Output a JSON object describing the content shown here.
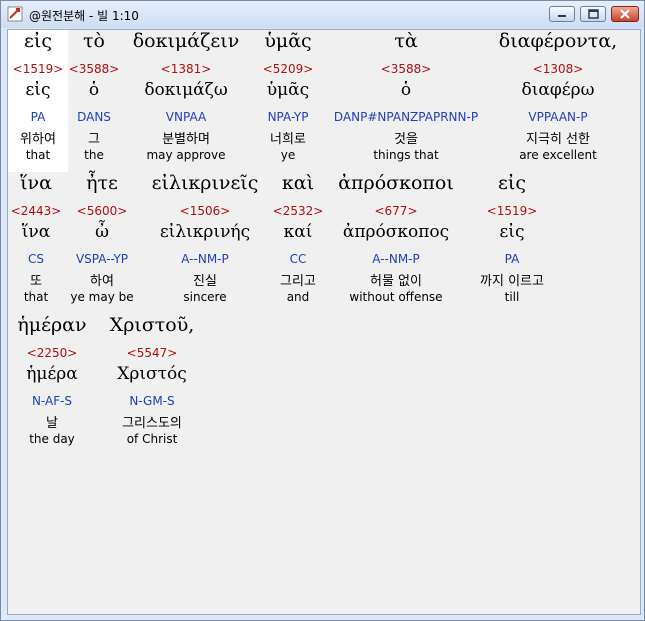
{
  "window": {
    "title": "@원전분해 - 빌 1:10",
    "controls": {
      "minimize": "minimize",
      "maximize": "maximize",
      "close": "close"
    }
  },
  "words": [
    {
      "greek": "εἰς",
      "strong": "<1519>",
      "lemma": "εἰς",
      "morph": "PA",
      "korean": "위하여",
      "english": "that"
    },
    {
      "greek": "τὸ",
      "strong": "<3588>",
      "lemma": "ὁ",
      "morph": "DANS",
      "korean": "그",
      "english": "the"
    },
    {
      "greek": "δοκιμάζειν",
      "strong": "<1381>",
      "lemma": "δοκιμάζω",
      "morph": "VNPAA",
      "korean": "분별하며",
      "english": "may approve"
    },
    {
      "greek": "ὑμᾶς",
      "strong": "<5209>",
      "lemma": "ὑμᾶς",
      "morph": "NPA-YP",
      "korean": "너희로",
      "english": "ye"
    },
    {
      "greek": "τὰ",
      "strong": "<3588>",
      "lemma": "ὁ",
      "morph": "DANP#NPANZPAPRNN-P",
      "korean": "것을",
      "english": "things that"
    },
    {
      "greek": "διαφέροντα,",
      "strong": "<1308>",
      "lemma": "διαφέρω",
      "morph": "VPPAAN-P",
      "korean": "지극히 선한",
      "english": "are excellent"
    },
    {
      "greek": "ἵνα",
      "strong": "<2443>",
      "lemma": "ἵνα",
      "morph": "CS",
      "korean": "또",
      "english": "that"
    },
    {
      "greek": "ἦτε",
      "strong": "<5600>",
      "lemma": "ὦ",
      "morph": "VSPA--YP",
      "korean": "하여",
      "english": "ye may be"
    },
    {
      "greek": "εἰλικρινεῖς",
      "strong": "<1506>",
      "lemma": "εἰλικρινής",
      "morph": "A--NM-P",
      "korean": "진실",
      "english": "sincere"
    },
    {
      "greek": "καὶ",
      "strong": "<2532>",
      "lemma": "καί",
      "morph": "CC",
      "korean": "그리고",
      "english": "and"
    },
    {
      "greek": "ἀπρόσκοποι",
      "strong": "<677>",
      "lemma": "ἀπρόσκοπος",
      "morph": "A--NM-P",
      "korean": "허물 없이",
      "english": "without offense"
    },
    {
      "greek": "εἰς",
      "strong": "<1519>",
      "lemma": "εἰς",
      "morph": "PA",
      "korean": "까지 이르고",
      "english": "till"
    },
    {
      "greek": "ἡμέραν",
      "strong": "<2250>",
      "lemma": "ἡμέρα",
      "morph": "N-AF-S",
      "korean": "날",
      "english": "the day"
    },
    {
      "greek": "Χριστοῦ,",
      "strong": "<5547>",
      "lemma": "Χριστός",
      "morph": "N-GM-S",
      "korean": "그리스도의",
      "english": "of Christ"
    }
  ]
}
